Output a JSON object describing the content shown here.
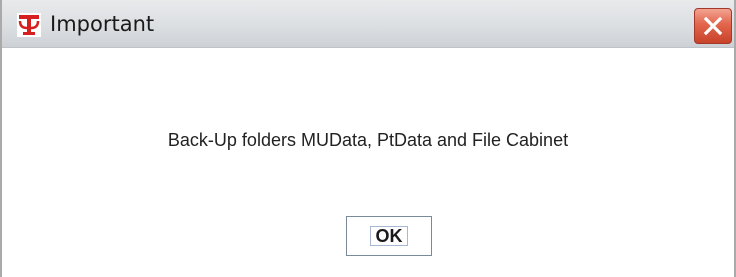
{
  "dialog": {
    "title": "Important",
    "message": "Back-Up folders MUData, PtData and File Cabinet",
    "ok_label": "OK",
    "icon": "app-logo-icon",
    "close_icon": "close-icon",
    "colors": {
      "logo_red": "#d62020",
      "close_red": "#e2654c",
      "titlebar": "#dcdfe2"
    }
  }
}
